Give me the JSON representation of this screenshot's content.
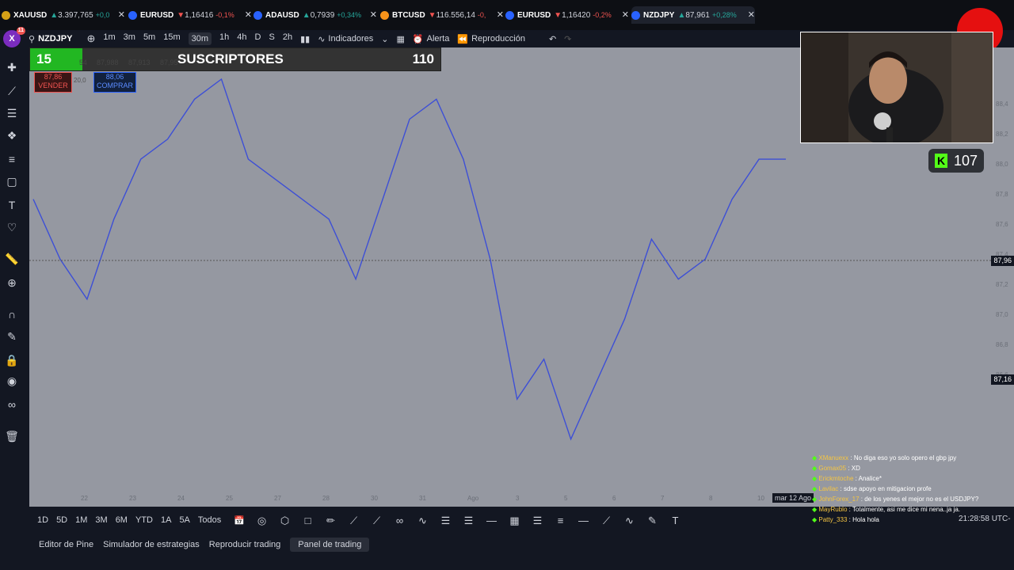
{
  "tabs": [
    {
      "symbol": "XAUUSD",
      "price": "3.397,765",
      "change": "+0,0",
      "dir": "up",
      "color": "#d4a017"
    },
    {
      "symbol": "EURUSD",
      "price": "1,16416",
      "change": "-0,1%",
      "dir": "down",
      "color": "#2962ff"
    },
    {
      "symbol": "ADAUSD",
      "price": "0,7939",
      "change": "+0,34%",
      "dir": "up",
      "color": "#2962ff"
    },
    {
      "symbol": "BTCUSD",
      "price": "116.556,14",
      "change": "-0,",
      "dir": "down",
      "color": "#f7931a"
    },
    {
      "symbol": "EURUSD",
      "price": "1,16420",
      "change": "-0,2%",
      "dir": "down",
      "color": "#2962ff"
    },
    {
      "symbol": "NZDJPY",
      "price": "87,961",
      "change": "+0,28%",
      "dir": "up",
      "color": "#2962ff"
    }
  ],
  "toolbar": {
    "logo": "X",
    "notif": "11",
    "symbol": "NZDJPY",
    "intervals": [
      "1m",
      "3m",
      "5m",
      "15m",
      "30m",
      "1h",
      "4h",
      "D",
      "S",
      "2h"
    ],
    "selected_interval": "30m",
    "indicators": "Indicadores",
    "alert": "Alerta",
    "replay": "Reproducción"
  },
  "subs": {
    "count": "15",
    "label": "SUSCRIPTORES",
    "goal": "110"
  },
  "ohlc": {
    "a": "54",
    "b": "87,988",
    "c": "87,913",
    "d": "87,95"
  },
  "trade": {
    "sell_price": "87,86",
    "sell_label": "VENDER",
    "spread": "20,0",
    "buy_price": "88,06",
    "buy_label": "COMPRAR"
  },
  "kick": {
    "viewers": "107"
  },
  "price_tags": {
    "current": "87,96",
    "crosshair": "87,16"
  },
  "date_badge": "mar 12 Ago",
  "chat": [
    {
      "user": "XManuexx",
      "msg": "No diga eso yo solo opero el gbp jpy"
    },
    {
      "user": "Gomax05",
      "msg": "XD"
    },
    {
      "user": "Erickmtoche",
      "msg": "Analice*"
    },
    {
      "user": "Lavilac",
      "msg": "sdse apoyo en mitigacion profe"
    },
    {
      "user": "JohnForex_17",
      "msg": "de los yenes el mejor no es el USDJPY?"
    },
    {
      "user": "MayRublo",
      "msg": "Totalmente, asi me dice mi nena..ja ja."
    },
    {
      "user": "Patty_333",
      "msg": "Hola hola"
    }
  ],
  "ranges": [
    "1D",
    "5D",
    "1M",
    "3M",
    "6M",
    "YTD",
    "1A",
    "5A",
    "Todos"
  ],
  "clock": "21:28:58 UTC-",
  "panels": [
    "Editor de Pine",
    "Simulador de estrategias",
    "Reproducir trading",
    "Panel de trading"
  ],
  "selected_panel": "Panel de trading",
  "chart_data": {
    "type": "line",
    "symbol": "NZDJPY",
    "interval": "30m",
    "x_ticks": [
      "22",
      "23",
      "24",
      "25",
      "27",
      "28",
      "30",
      "31",
      "Ago",
      "3",
      "5",
      "6",
      "7",
      "8",
      "10"
    ],
    "ylim": [
      86.4,
      88.3
    ],
    "y_ticks": [
      "88,4",
      "88,2",
      "88,0",
      "87,8",
      "87,6",
      "87,4",
      "87,2",
      "87,0",
      "86,8",
      "86,6"
    ],
    "series": [
      {
        "values": [
          87.7,
          87.4,
          87.2,
          87.6,
          87.9,
          88.0,
          88.2,
          88.3,
          87.9,
          87.8,
          87.7,
          87.6,
          87.3,
          87.7,
          88.1,
          88.2,
          87.9,
          87.4,
          86.7,
          86.9,
          86.5,
          86.8,
          87.1,
          87.5,
          87.3,
          87.4,
          87.7,
          87.9,
          87.9
        ]
      }
    ]
  }
}
